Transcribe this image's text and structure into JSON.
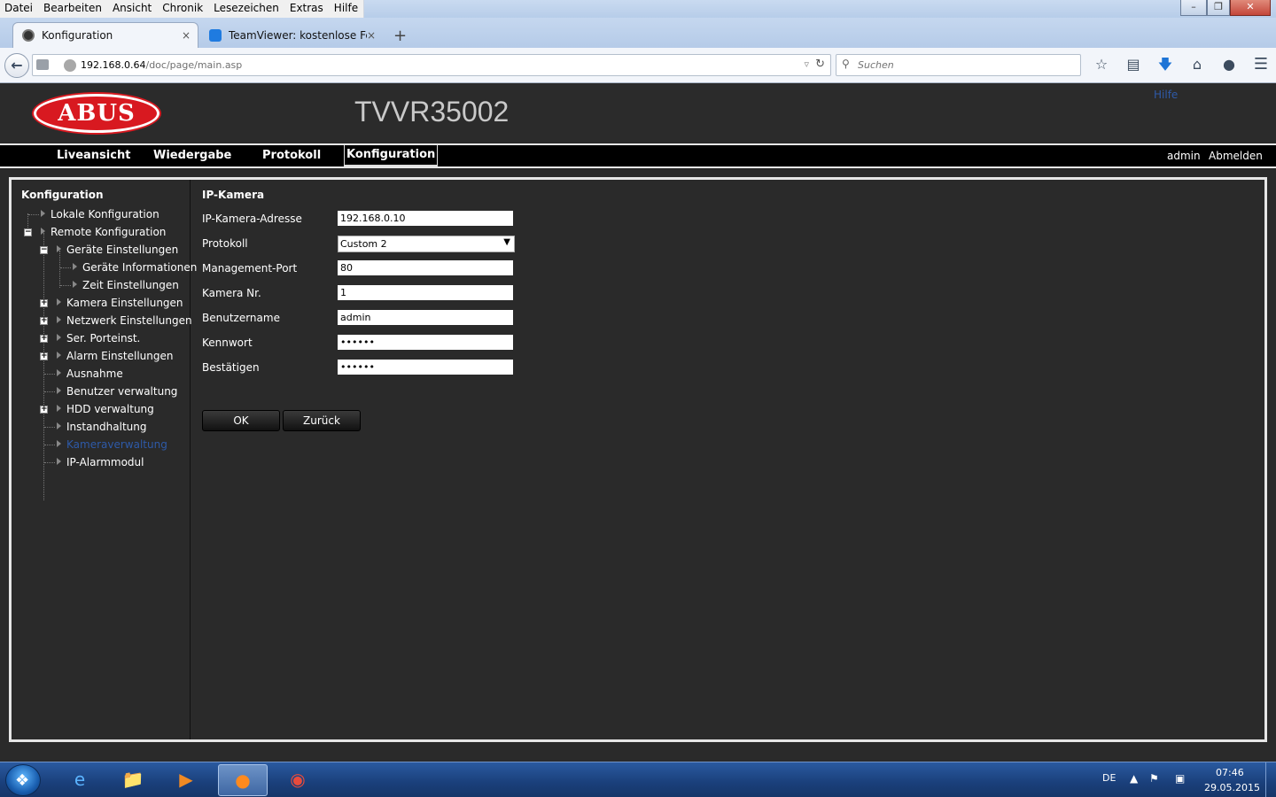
{
  "browser": {
    "menu": [
      "Datei",
      "Bearbeiten",
      "Ansicht",
      "Chronik",
      "Lesezeichen",
      "Extras",
      "Hilfe"
    ],
    "tabs": [
      {
        "label": "Konfiguration",
        "close": "×"
      },
      {
        "label": "TeamViewer: kostenlose Fe...",
        "close": "×"
      }
    ],
    "new_tab": "+",
    "url_host": "192.168.0.64",
    "url_path": "/doc/page/main.asp",
    "search_placeholder": "Suchen",
    "window_controls": {
      "minimize": "–",
      "maximize": "❐",
      "close": "✕"
    }
  },
  "app": {
    "logo_text": "ABUS",
    "device_title": "TVVR35002",
    "help_link": "Hilfe",
    "nav": [
      "Liveansicht",
      "Wiedergabe",
      "Protokoll",
      "Konfiguration"
    ],
    "active_nav": "Konfiguration",
    "user": "admin",
    "logout": "Abmelden",
    "sidebar": {
      "title": "Konfiguration",
      "items": [
        {
          "label": "Lokale Konfiguration",
          "toggle": ""
        },
        {
          "label": "Remote Konfiguration",
          "toggle": "−"
        },
        {
          "label": "Geräte Einstellungen",
          "toggle": "−"
        },
        {
          "label": "Geräte Informationen",
          "toggle": ""
        },
        {
          "label": "Zeit Einstellungen",
          "toggle": ""
        },
        {
          "label": "Kamera Einstellungen",
          "toggle": "+"
        },
        {
          "label": "Netzwerk Einstellungen",
          "toggle": "+"
        },
        {
          "label": "Ser. Porteinst.",
          "toggle": "+"
        },
        {
          "label": "Alarm Einstellungen",
          "toggle": "+"
        },
        {
          "label": "Ausnahme",
          "toggle": ""
        },
        {
          "label": "Benutzer verwaltung",
          "toggle": ""
        },
        {
          "label": "HDD verwaltung",
          "toggle": "+"
        },
        {
          "label": "Instandhaltung",
          "toggle": ""
        },
        {
          "label": "Kameraverwaltung",
          "toggle": ""
        },
        {
          "label": "IP-Alarmmodul",
          "toggle": ""
        }
      ],
      "current": "Kameraverwaltung"
    },
    "panel": {
      "title": "IP-Kamera",
      "fields": [
        {
          "label": "IP-Kamera-Adresse",
          "value": "192.168.0.10"
        },
        {
          "label": "Protokoll",
          "value": "Custom 2"
        },
        {
          "label": "Management-Port",
          "value": "80"
        },
        {
          "label": "Kamera Nr.",
          "value": "1"
        },
        {
          "label": "Benutzername",
          "value": "admin"
        },
        {
          "label": "Kennwort",
          "value": "••••••"
        },
        {
          "label": "Bestätigen",
          "value": "••••••"
        }
      ],
      "ok_label": "OK",
      "back_label": "Zurück"
    }
  },
  "taskbar": {
    "language": "DE",
    "time": "07:46",
    "date": "29.05.2015"
  },
  "colors": {
    "ui_background": "#2a2a2a",
    "logo_red": "#d81920",
    "link_blue": "#2e5aa8",
    "taskbar_blue": "#1a3f7a"
  }
}
